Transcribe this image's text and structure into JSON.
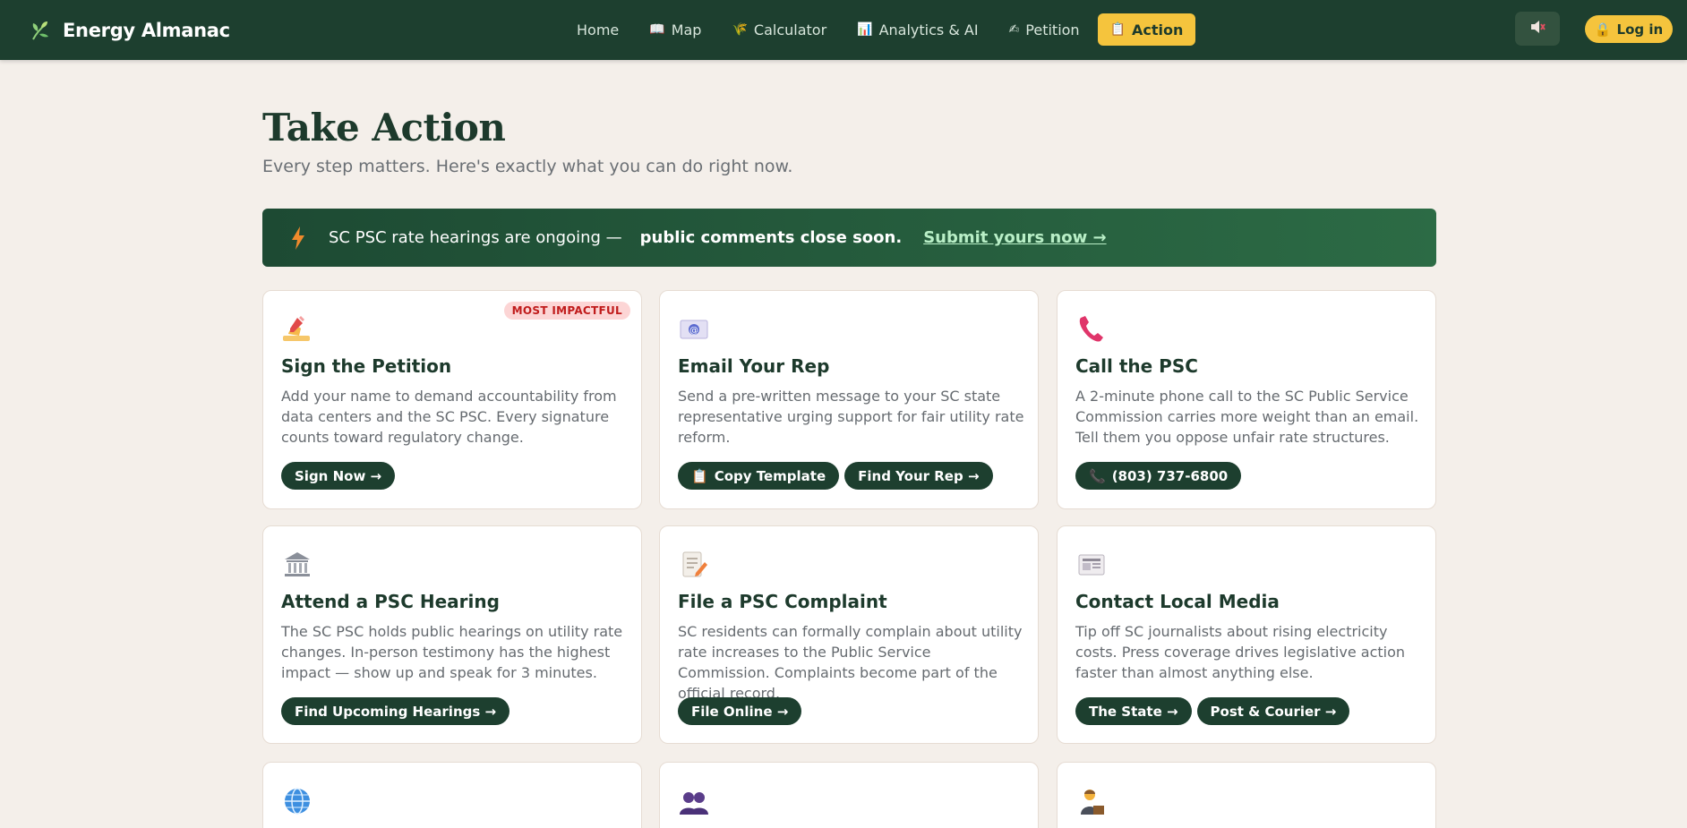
{
  "nav": {
    "brand": "Energy Almanac",
    "items": [
      {
        "label": "Home",
        "glyph": ""
      },
      {
        "label": "Map",
        "glyph": "📖"
      },
      {
        "label": "Calculator",
        "glyph": "🌾"
      },
      {
        "label": "Analytics & AI",
        "glyph": "📊"
      },
      {
        "label": "Petition",
        "glyph": "✍"
      },
      {
        "label": "Action",
        "glyph": "📋"
      }
    ],
    "active": "Action",
    "login_label": "Log in",
    "login_glyph": "🔒"
  },
  "page": {
    "title": "Take Action",
    "subtitle": "Every step matters. Here's exactly what you can do right now."
  },
  "banner": {
    "text": "SC PSC rate hearings are ongoing —",
    "bold": "public comments close soon.",
    "link": "Submit yours now →"
  },
  "cards": [
    {
      "title": "Sign the Petition",
      "badge": "MOST IMPACTFUL",
      "icon": "writing-hand-icon",
      "description": "Add your name to demand accountability from data centers and the SC PSC. Every signature counts toward regulatory change.",
      "actions": [
        {
          "label": "Sign Now →",
          "glyph": ""
        }
      ]
    },
    {
      "title": "Email Your Rep",
      "icon": "email-icon",
      "description": "Send a pre-written message to your SC state representative urging support for fair utility rate reform.",
      "actions": [
        {
          "label": "Copy Template",
          "glyph": "📋"
        },
        {
          "label": "Find Your Rep →",
          "glyph": ""
        }
      ]
    },
    {
      "title": "Call the PSC",
      "icon": "phone-icon",
      "description": "A 2-minute phone call to the SC Public Service Commission carries more weight than an email. Tell them you oppose unfair rate structures.",
      "actions": [
        {
          "label": "(803) 737-6800",
          "glyph": "📞"
        }
      ]
    },
    {
      "title": "Attend a PSC Hearing",
      "icon": "government-building-icon",
      "description": "The SC PSC holds public hearings on utility rate changes. In-person testimony has the highest impact — show up and speak for 3 minutes.",
      "actions": [
        {
          "label": "Find Upcoming Hearings →",
          "glyph": ""
        }
      ]
    },
    {
      "title": "File a PSC Complaint",
      "icon": "document-pencil-icon",
      "description": "SC residents can formally complain about utility rate increases to the Public Service Commission. Complaints become part of the official record.",
      "actions": [
        {
          "label": "File Online →",
          "glyph": ""
        }
      ]
    },
    {
      "title": "Contact Local Media",
      "icon": "newspaper-icon",
      "description": "Tip off SC journalists about rising electricity costs. Press coverage drives legislative action faster than almost anything else.",
      "actions": [
        {
          "label": "The State →",
          "glyph": ""
        },
        {
          "label": "Post & Courier →",
          "glyph": ""
        }
      ]
    },
    {
      "title": "",
      "icon": "globe-icon",
      "description": "",
      "actions": []
    },
    {
      "title": "",
      "icon": "people-icon",
      "description": "",
      "actions": []
    },
    {
      "title": "",
      "icon": "person-at-podium-icon",
      "description": "",
      "actions": []
    }
  ]
}
